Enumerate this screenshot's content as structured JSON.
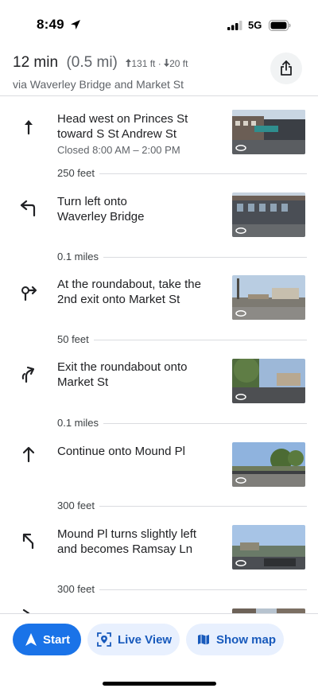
{
  "status_bar": {
    "time": "8:49",
    "network": "5G"
  },
  "header": {
    "duration": "12 min",
    "distance": "(0.5 mi)",
    "ascent": "131 ft",
    "separator": "·",
    "descent": "20 ft",
    "via": "via Waverley Bridge and Market St"
  },
  "steps": [
    {
      "icon": "straight-arrow-icon",
      "line1": "Head west on Princes St",
      "line2": "toward S St Andrew St",
      "sub": "Closed 8:00 AM – 2:00 PM",
      "distance_after": "250 feet"
    },
    {
      "icon": "turn-left-icon",
      "line1": "Turn left onto",
      "line2": "Waverley Bridge",
      "distance_after": "0.1 miles"
    },
    {
      "icon": "roundabout-icon",
      "line1": "At the roundabout, take the",
      "line2": "2nd exit onto Market St",
      "distance_after": "50 feet"
    },
    {
      "icon": "exit-roundabout-icon",
      "line1": "Exit the roundabout onto",
      "line2": "Market St",
      "distance_after": "0.1 miles"
    },
    {
      "icon": "straight-arrow-icon",
      "line1": "Continue onto Mound Pl",
      "distance_after": "300 feet"
    },
    {
      "icon": "slight-left-icon",
      "line1": "Mound Pl turns slightly left",
      "line2": "and becomes Ramsay Ln",
      "distance_after": "300 feet"
    }
  ],
  "bottom_bar": {
    "start_label": "Start",
    "live_view_label": "Live View",
    "show_map_label": "Show map"
  },
  "colors": {
    "accent": "#1a73e8",
    "chip_background": "#e8f0fe",
    "chip_text": "#185abc",
    "secondary_text": "#5f6368"
  }
}
